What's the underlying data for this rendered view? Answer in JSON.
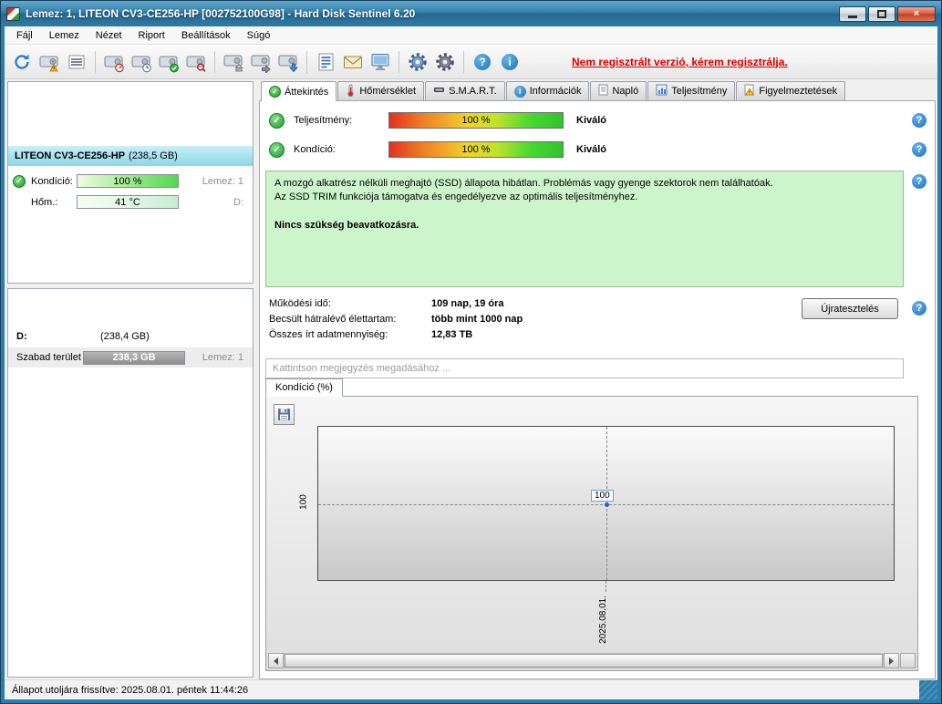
{
  "window": {
    "title": "Lemez: 1, LITEON CV3-CE256-HP [002752100G98]  -  Hard Disk Sentinel 6.20"
  },
  "icons": {
    "check": "✓",
    "help": "?",
    "info": "i",
    "close": "×"
  },
  "menu": {
    "items": [
      {
        "label": "Fájl"
      },
      {
        "label": "Lemez"
      },
      {
        "label": "Nézet"
      },
      {
        "label": "Riport"
      },
      {
        "label": "Beállítások"
      },
      {
        "label": "Súgó"
      }
    ]
  },
  "toolbar": {
    "register_notice": "Nem regisztrált verzió, kérem regisztrálja."
  },
  "sidebar": {
    "disk": {
      "name": "LITEON CV3-CE256-HP",
      "size": "(238,5 GB)",
      "condition_label": "Kondíció:",
      "condition_value": "100 %",
      "disk_label": "Lemez: 1",
      "temp_label": "Hőm.:",
      "temp_value": "41 °C",
      "drive_letter": "D:"
    },
    "partition": {
      "drive": "D:",
      "size": "(238,4 GB)",
      "free_label": "Szabad terület",
      "free_value": "238,3 GB",
      "disk_label": "Lemez: 1"
    }
  },
  "tabs": [
    {
      "label": "Áttekintés"
    },
    {
      "label": "Hőmérséklet"
    },
    {
      "label": "S.M.A.R.T."
    },
    {
      "label": "Információk"
    },
    {
      "label": "Napló"
    },
    {
      "label": "Teljesítmény"
    },
    {
      "label": "Figyelmeztetések"
    }
  ],
  "overview": {
    "performance_label": "Teljesítmény:",
    "performance_value": "100 %",
    "performance_rating": "Kiváló",
    "condition_label": "Kondíció:",
    "condition_value": "100 %",
    "condition_rating": "Kiváló",
    "status_line1": "A mozgó alkatrész nélküli meghajtó (SSD) állapota hibátlan. Problémás vagy gyenge szektorok nem találhatóak.",
    "status_line2": "Az SSD TRIM funkciója támogatva és engedélyezve az optimális teljesítményhez.",
    "status_bold": "Nincs szükség beavatkozásra.",
    "power_on_label": "Működési idő:",
    "power_on_value": "109 nap, 19 óra",
    "lifetime_label": "Becsült hátralévő élettartam:",
    "lifetime_value": "több mint 1000 nap",
    "written_label": "Összes írt adatmennyiség:",
    "written_value": "12,83 TB",
    "retest_button": "Újratesztelés",
    "comment_placeholder": "Kattintson megjegyzés megadásához ..."
  },
  "chart": {
    "tab_label": "Kondíció  (%)",
    "type": "line",
    "x": [
      "2025.08.01."
    ],
    "values": [
      100
    ],
    "y_tick": "100",
    "point_label": "100"
  },
  "colors": {
    "health_green": "#2fc42f",
    "selection_cyan": "#8bd6e8",
    "register_red": "#d40000",
    "status_box_green": "#cdf5cb"
  },
  "statusbar": {
    "text": "Állapot utoljára frissítve: 2025.08.01. péntek 11:44:26"
  }
}
